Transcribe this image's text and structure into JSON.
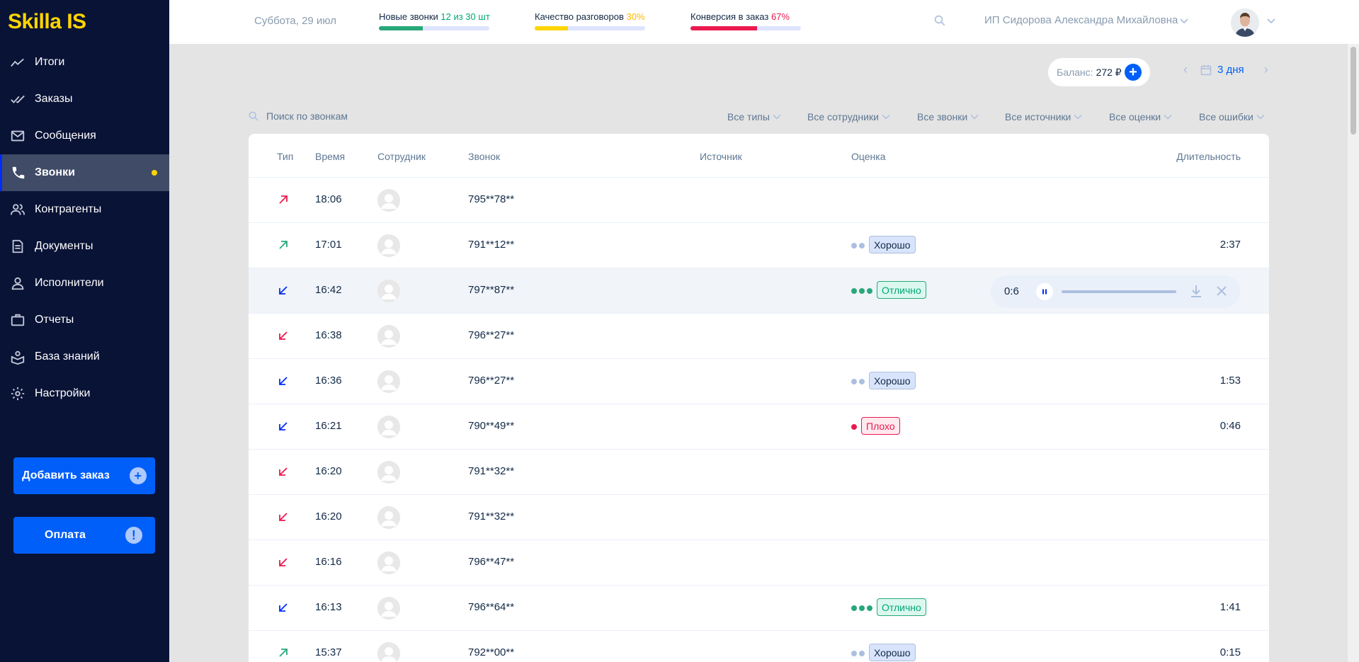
{
  "app": {
    "logo": "Skilla IS"
  },
  "sidebar": {
    "items": [
      {
        "label": "Итоги",
        "icon": "chart-line-icon"
      },
      {
        "label": "Заказы",
        "icon": "double-check-icon"
      },
      {
        "label": "Сообщения",
        "icon": "mail-icon"
      },
      {
        "label": "Звонки",
        "icon": "phone-icon",
        "active": true
      },
      {
        "label": "Контрагенты",
        "icon": "people-icon"
      },
      {
        "label": "Документы",
        "icon": "document-icon"
      },
      {
        "label": "Исполнители",
        "icon": "person-icon"
      },
      {
        "label": "Отчеты",
        "icon": "briefcase-icon"
      },
      {
        "label": "База знаний",
        "icon": "book-icon"
      },
      {
        "label": "Настройки",
        "icon": "gear-icon"
      }
    ],
    "add_order_label": "Добавить заказ",
    "payment_label": "Оплата"
  },
  "header": {
    "date": "Суббота, 29 июл",
    "stats": [
      {
        "label": "Новые звонки ",
        "value": "12 из 30 шт",
        "value_color": "#00a775",
        "progress": 0.4,
        "bar_color": "#28a879"
      },
      {
        "label": "Качество разговоров ",
        "value": "30%",
        "value_color": "#ffb800",
        "progress": 0.3,
        "bar_color": "#ffd500"
      },
      {
        "label": "Конверсия в заказ ",
        "value": "67%",
        "value_color": "#ea1a4f",
        "progress": 0.6,
        "bar_color": "#ea1a4f"
      }
    ],
    "user_name": "ИП Сидорова Александра Михайловна"
  },
  "toolbar": {
    "balance_label": "Баланс:",
    "balance_value": "272 ₽",
    "period_label": "3 дня",
    "search_placeholder": "Поиск по звонкам",
    "filters": [
      "Все типы",
      "Все сотрудники",
      "Все звонки",
      "Все источники",
      "Все оценки",
      "Все ошибки"
    ]
  },
  "table": {
    "headers": {
      "type": "Тип",
      "time": "Время",
      "employee": "Сотрудник",
      "call": "Звонок",
      "source": "Источник",
      "rating": "Оценка",
      "duration": "Длительность"
    },
    "rows": [
      {
        "dir": "outgoing-missed",
        "time": "18:06",
        "phone": "795**78**",
        "rating": "",
        "dots": 0,
        "duration": ""
      },
      {
        "dir": "outgoing",
        "time": "17:01",
        "phone": "791**12**",
        "rating": "Хорошо",
        "rating_kind": "good",
        "dots": 2,
        "duration": "2:37"
      },
      {
        "dir": "incoming",
        "time": "16:42",
        "phone": "797**87**",
        "rating": "Отлично",
        "rating_kind": "excellent",
        "dots": 3,
        "duration": "",
        "player": true
      },
      {
        "dir": "incoming-missed",
        "time": "16:38",
        "phone": "796**27**",
        "rating": "",
        "dots": 0,
        "duration": ""
      },
      {
        "dir": "incoming",
        "time": "16:36",
        "phone": "796**27**",
        "rating": "Хорошо",
        "rating_kind": "good",
        "dots": 2,
        "duration": "1:53"
      },
      {
        "dir": "incoming",
        "time": "16:21",
        "phone": "790**49**",
        "rating": "Плохо",
        "rating_kind": "bad",
        "dots": 1,
        "duration": "0:46"
      },
      {
        "dir": "incoming-missed",
        "time": "16:20",
        "phone": "791**32**",
        "rating": "",
        "dots": 0,
        "duration": ""
      },
      {
        "dir": "incoming-missed",
        "time": "16:20",
        "phone": "791**32**",
        "rating": "",
        "dots": 0,
        "duration": ""
      },
      {
        "dir": "incoming-missed",
        "time": "16:16",
        "phone": "796**47**",
        "rating": "",
        "dots": 0,
        "duration": ""
      },
      {
        "dir": "incoming",
        "time": "16:13",
        "phone": "796**64**",
        "rating": "Отлично",
        "rating_kind": "excellent",
        "dots": 3,
        "duration": "1:41"
      },
      {
        "dir": "outgoing",
        "time": "15:37",
        "phone": "792**00**",
        "rating": "Хорошо",
        "rating_kind": "good",
        "dots": 2,
        "duration": "0:15"
      }
    ]
  },
  "player": {
    "time": "0:6",
    "progress": 0
  },
  "colors": {
    "sidebar_bg": "#091336",
    "accent": "#005ff8",
    "brand_yellow": "#ffd500",
    "incoming": "#002cfb",
    "outgoing": "#28a879",
    "missed": "#ea1a4f"
  }
}
